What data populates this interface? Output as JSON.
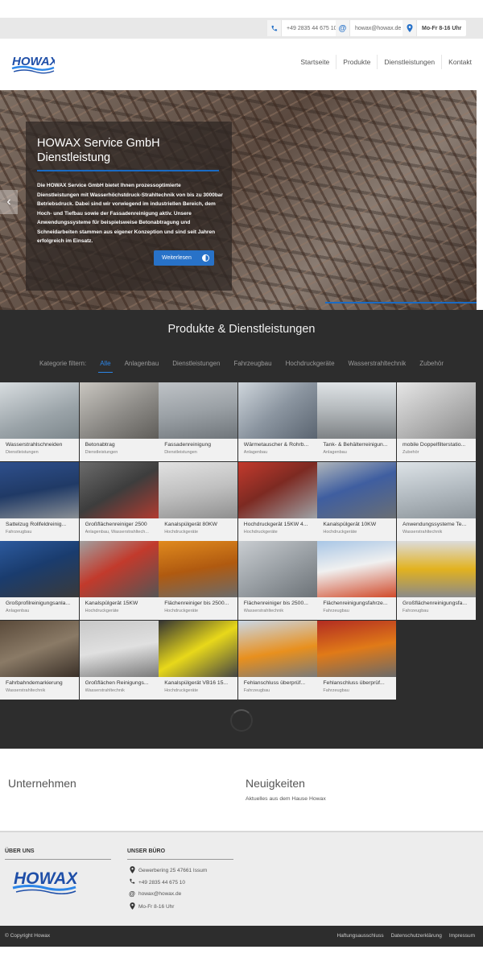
{
  "contact": {
    "phone": "+49 2835 44 675 10",
    "email": "howax@howax.de",
    "hours": "Mo-Fr 8-16 Uhr"
  },
  "brand": {
    "logo_text": "HOWAX",
    "accent": "#2872c8",
    "logo_color": "#1f4fa8"
  },
  "nav": {
    "items": [
      "Startseite",
      "Produkte",
      "Dienstleistungen",
      "Kontakt"
    ]
  },
  "hero": {
    "title": "HOWAX Service GmbH Dienstleistung",
    "text": "Die HOWAX Service GmbH bietet Ihnen prozessoptimierte Dienstleistungen mit Wasserhöchstdruck-Strahltechnik von bis zu 3000bar Betriebsdruck. Dabei sind wir vorwiegend im industriellen Bereich, dem Hoch- und Tiefbau sowie der Fassadenreinigung aktiv. Unsere Anwendungssysteme für beispielsweise Betonabtragung und Schneidarbeiten stammen aus eigener Konzeption und sind seit Jahren erfolgreich im Einsatz.",
    "button": "Weiterlesen",
    "prev_icon": "chevron-left-icon"
  },
  "products": {
    "title": "Produkte & Dienstleistungen",
    "filter_label": "Kategorie filtern:",
    "filters": [
      "Alle",
      "Anlagenbau",
      "Dienstleistungen",
      "Fahrzeugbau",
      "Hochdruckgeräte",
      "Wasserstrahltechnik",
      "Zubehör"
    ],
    "active_filter": "Alle",
    "items": [
      {
        "name": "Wasserstrahlschneiden",
        "category": "Dienstleistungen"
      },
      {
        "name": "Betonabtrag",
        "category": "Dienstleistungen"
      },
      {
        "name": "Fassadenreinigung",
        "category": "Dienstleistungen"
      },
      {
        "name": "Wärmetauscher & Rohrb...",
        "category": "Anlagenbau"
      },
      {
        "name": "Tank- & Behälterreinigun...",
        "category": "Anlagenbau"
      },
      {
        "name": "mobile Doppelfilterstatio...",
        "category": "Zubehör"
      },
      {
        "name": "Sattelzug Rollfeldreinig...",
        "category": "Fahrzeugbau"
      },
      {
        "name": "Großflächenreiniger 2500",
        "category": "Anlagenbau, Wasserstrahltech..."
      },
      {
        "name": "Kanalspülgerät 80KW",
        "category": "Hochdruckgeräte"
      },
      {
        "name": "Hochdruckgerät 15KW 4...",
        "category": "Hochdruckgeräte"
      },
      {
        "name": "Kanalspülgerät 10KW",
        "category": "Hochdruckgeräte"
      },
      {
        "name": "Anwendungssysteme Te...",
        "category": "Wasserstrahltechnik"
      },
      {
        "name": "Großprofilreinigungsanla...",
        "category": "Anlagenbau"
      },
      {
        "name": "Kanalspülgerät 15KW",
        "category": "Hochdruckgeräte"
      },
      {
        "name": "Flächenreiniger bis 2500...",
        "category": "Hochdruckgeräte"
      },
      {
        "name": "Flächenreiniger bis 2500...",
        "category": "Wasserstrahltechnik"
      },
      {
        "name": "Flächenreinigungsfahrze...",
        "category": "Fahrzeugbau"
      },
      {
        "name": "Großflächenreinigungsfa...",
        "category": "Fahrzeugbau"
      },
      {
        "name": "Fahrbahndemarkierung",
        "category": "Wasserstrahltechnik"
      },
      {
        "name": "Großflächen Reinigungs...",
        "category": "Wasserstrahltechnik"
      },
      {
        "name": "Kanalspülgerät VB16 15...",
        "category": "Hochdruckgeräte"
      },
      {
        "name": "Fehlanschluss überprüf...",
        "category": "Fahrzeugbau"
      },
      {
        "name": "Fehlanschluss überprüf...",
        "category": "Fahrzeugbau"
      }
    ]
  },
  "section2": {
    "company_heading": "Unternehmen",
    "news_heading": "Neuigkeiten",
    "news_sub": "Aktuelles aus dem Hause Howax"
  },
  "footer": {
    "about_heading": "ÜBER UNS",
    "office_heading": "UNSER BÜRO",
    "address": "Gewerbering 25 47661 Issum",
    "phone": "+49 2835 44 675 10",
    "email": "howax@howax.de",
    "hours": "Mo-Fr 8-16 Uhr"
  },
  "bottom": {
    "copyright": "© Copyright Howax",
    "links": [
      "Haftungsausschluss",
      "Datenschutzerklärung",
      "Impressum"
    ]
  }
}
